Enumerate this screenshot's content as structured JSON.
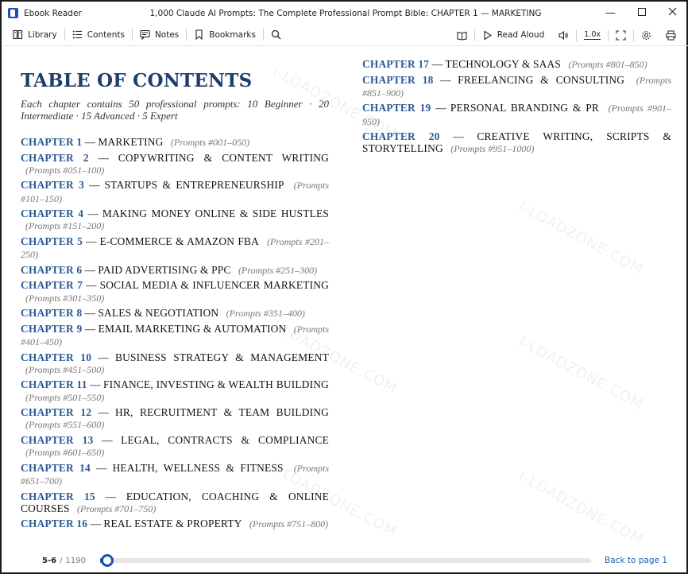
{
  "window": {
    "app_name": "Ebook Reader",
    "title": "1,000 Claude AI Prompts: The Complete Professional Prompt Bible: CHAPTER 1 — MARKETING"
  },
  "toolbar": {
    "library": "Library",
    "contents": "Contents",
    "notes": "Notes",
    "bookmarks": "Bookmarks",
    "read_aloud": "Read Aloud",
    "speed": "1.0x"
  },
  "toc": {
    "title": "TABLE OF CONTENTS",
    "subtitle": "Each chapter contains 50 professional prompts: 10 Beginner · 20 Intermediate · 15 Advanced · 5 Expert",
    "chapters": [
      {
        "num": "CHAPTER 1",
        "name": "MARKETING",
        "range": "(Prompts #001–050)"
      },
      {
        "num": "CHAPTER 2",
        "name": "COPYWRITING & CONTENT WRITING",
        "range": "(Prompts #051–100)"
      },
      {
        "num": "CHAPTER 3",
        "name": "STARTUPS & ENTREPRENEURSHIP",
        "range": "(Prompts #101–150)"
      },
      {
        "num": "CHAPTER 4",
        "name": "MAKING MONEY ONLINE & SIDE HUSTLES",
        "range": "(Prompts #151–200)"
      },
      {
        "num": "CHAPTER 5",
        "name": "E-COMMERCE & AMAZON FBA",
        "range": "(Prompts #201–250)"
      },
      {
        "num": "CHAPTER 6",
        "name": "PAID ADVERTISING & PPC",
        "range": "(Prompts #251–300)"
      },
      {
        "num": "CHAPTER 7",
        "name": "SOCIAL MEDIA & INFLUENCER MARKETING",
        "range": "(Prompts #301–350)"
      },
      {
        "num": "CHAPTER 8",
        "name": "SALES & NEGOTIATION",
        "range": "(Prompts #351–400)"
      },
      {
        "num": "CHAPTER 9",
        "name": "EMAIL MARKETING & AUTOMATION",
        "range": "(Prompts #401–450)"
      },
      {
        "num": "CHAPTER 10",
        "name": "BUSINESS STRATEGY & MANAGEMENT",
        "range": "(Prompts #451–500)"
      },
      {
        "num": "CHAPTER 11",
        "name": "FINANCE, INVESTING & WEALTH BUILDING",
        "range": "(Prompts #501–550)"
      },
      {
        "num": "CHAPTER 12",
        "name": "HR, RECRUITMENT & TEAM BUILDING",
        "range": "(Prompts #551–600)"
      },
      {
        "num": "CHAPTER 13",
        "name": "LEGAL, CONTRACTS & COMPLIANCE",
        "range": "(Prompts #601–650)"
      },
      {
        "num": "CHAPTER 14",
        "name": "HEALTH, WELLNESS & FITNESS",
        "range": "(Prompts #651–700)"
      },
      {
        "num": "CHAPTER 15",
        "name": "EDUCATION, COACHING & ONLINE COURSES",
        "range": "(Prompts #701–750)"
      },
      {
        "num": "CHAPTER 16",
        "name": "REAL ESTATE & PROPERTY",
        "range": "(Prompts #751–800)"
      },
      {
        "num": "CHAPTER 17",
        "name": "TECHNOLOGY & SAAS",
        "range": "(Prompts #801–850)"
      },
      {
        "num": "CHAPTER 18",
        "name": "FREELANCING & CONSULTING",
        "range": "(Prompts #851–900)"
      },
      {
        "num": "CHAPTER 19",
        "name": "PERSONAL BRANDING & PR",
        "range": "(Prompts #901–950)"
      },
      {
        "num": "CHAPTER 20",
        "name": "CREATIVE WRITING, SCRIPTS & STORYTELLING",
        "range": "(Prompts #951–1000)"
      }
    ]
  },
  "watermark": "I-LOADZONE.COM",
  "footer": {
    "current_pages": "5-6",
    "separator": "/",
    "total_pages": "1190",
    "progress_fraction": 0.005,
    "back_link": "Back to page 1"
  },
  "colors": {
    "accent": "#1f4fb5",
    "chapter_blue": "#2a5a95",
    "heading": "#1e3f6e"
  }
}
